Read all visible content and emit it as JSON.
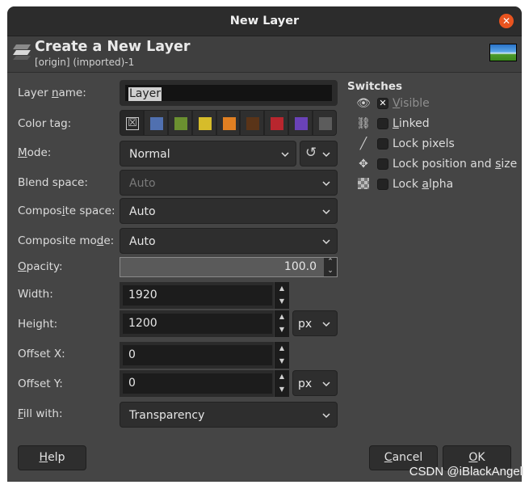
{
  "window": {
    "title": "New Layer"
  },
  "header": {
    "title": "Create a New Layer",
    "subtitle": "[origin] (imported)-1"
  },
  "form": {
    "layer_name": {
      "label_pre": "Layer ",
      "label_u": "n",
      "label_post": "ame:",
      "value": "Layer"
    },
    "color_tag": {
      "label": "Color tag:",
      "none_glyph": "☒",
      "colors": [
        "#5070b0",
        "#6b9030",
        "#d6bc2a",
        "#e07f22",
        "#5a3418",
        "#b8262e",
        "#6a42b8",
        "#5c5c5c"
      ]
    },
    "mode": {
      "label_u": "M",
      "label_post": "ode:",
      "value": "Normal"
    },
    "blend_space": {
      "label": "Blend space:",
      "value": "Auto"
    },
    "composite_space": {
      "label_pre": "Compos",
      "label_u": "i",
      "label_post": "te space:",
      "value": "Auto"
    },
    "composite_mode": {
      "label_pre": "Composite mo",
      "label_u": "d",
      "label_post": "e:",
      "value": "Auto"
    },
    "opacity": {
      "label_u": "O",
      "label_post": "pacity:",
      "value": "100.0"
    },
    "width": {
      "label": "Width:",
      "value": "1920"
    },
    "height": {
      "label": "Height:",
      "value": "1200"
    },
    "size_unit": "px",
    "offset_x": {
      "label": "Offset X:",
      "value": "0"
    },
    "offset_y": {
      "label": "Offset Y:",
      "value": "0"
    },
    "offset_unit": "px",
    "fill_with": {
      "label_u": "F",
      "label_post": "ill with:",
      "value": "Transparency"
    }
  },
  "switches": {
    "title": "Switches",
    "items": [
      {
        "label_pre": "",
        "label_u": "V",
        "label_post": "isible",
        "checked": true,
        "icon": "eye-icon"
      },
      {
        "label_pre": "",
        "label_u": "L",
        "label_post": "inked",
        "checked": false,
        "icon": "chain-icon"
      },
      {
        "label_pre": "Lock pixels",
        "label_u": "",
        "label_post": "",
        "checked": false,
        "icon": "brush-icon"
      },
      {
        "label_pre": "Lock position and ",
        "label_u": "s",
        "label_post": "ize",
        "checked": false,
        "icon": "move-icon"
      },
      {
        "label_pre": "Lock ",
        "label_u": "a",
        "label_post": "lpha",
        "checked": false,
        "icon": "checkerboard-icon"
      }
    ]
  },
  "buttons": {
    "help_u": "H",
    "help_post": "elp",
    "cancel_u": "C",
    "cancel_post": "ancel",
    "ok_u": "O",
    "ok_post": "K"
  },
  "watermark": "CSDN @iBlackAngel"
}
